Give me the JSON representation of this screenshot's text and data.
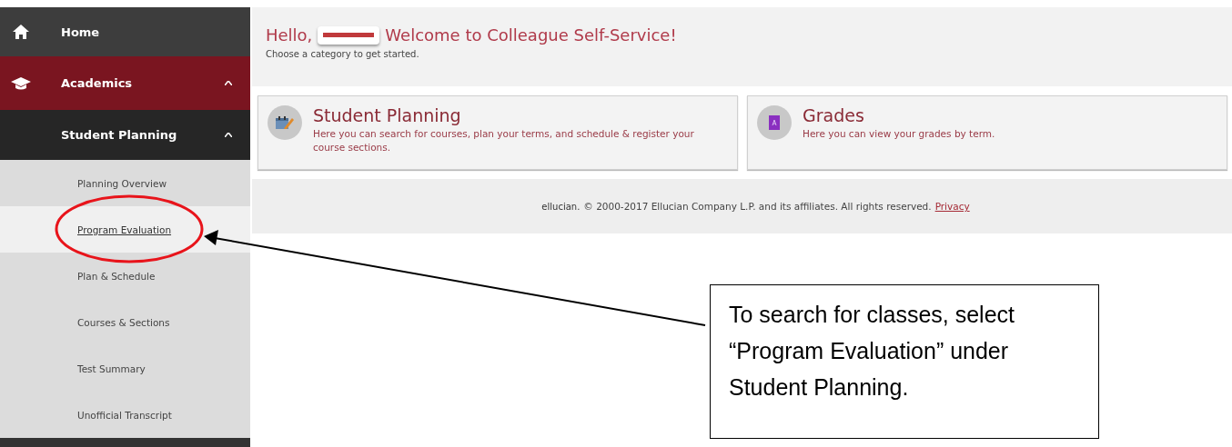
{
  "sidebar": {
    "items": [
      {
        "label": "Home",
        "kind": "top",
        "selected": false
      },
      {
        "label": "Academics",
        "kind": "section",
        "expanded": true,
        "selected": false
      },
      {
        "label": "Student Planning",
        "kind": "group",
        "expanded": true,
        "selected": false
      },
      {
        "label": "Planning Overview",
        "kind": "link",
        "selected": false
      },
      {
        "label": "Program Evaluation",
        "kind": "link",
        "selected": true
      },
      {
        "label": "Plan & Schedule",
        "kind": "link",
        "selected": false
      },
      {
        "label": "Courses & Sections",
        "kind": "link",
        "selected": false
      },
      {
        "label": "Test Summary",
        "kind": "link",
        "selected": false
      },
      {
        "label": "Unofficial Transcript",
        "kind": "link",
        "selected": false
      }
    ]
  },
  "header": {
    "greeting": "Hello,",
    "welcome": "Welcome to Colleague Self-Service!",
    "subtitle": "Choose a category to get started."
  },
  "cards": [
    {
      "title": "Student Planning",
      "description": "Here you can search for courses, plan your terms, and schedule & register your course sections."
    },
    {
      "title": "Grades",
      "description": "Here you can view your grades by term."
    }
  ],
  "footer": {
    "brand": "ellucian.",
    "copyright": "© 2000-2017 Ellucian Company L.P. and its affiliates. All rights reserved.",
    "link": "Privacy"
  },
  "callout": {
    "text": "To search for classes, select “Program Evaluation” under Student Planning."
  }
}
